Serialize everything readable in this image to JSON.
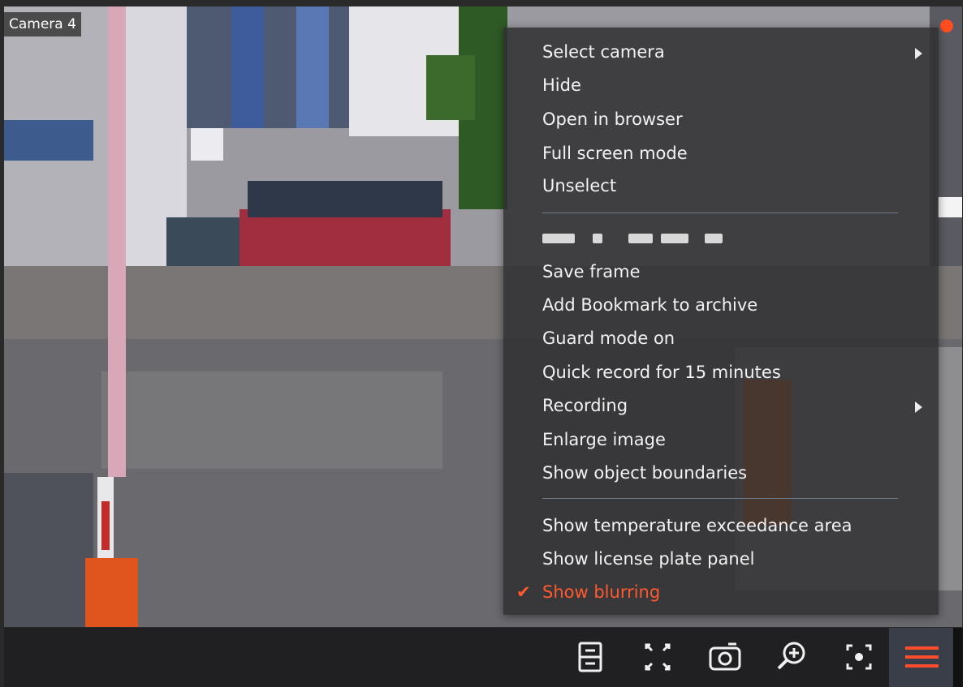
{
  "camera": {
    "label": "Camera 4",
    "recording_indicator_color": "#ff4d1f"
  },
  "context_menu": {
    "items": [
      {
        "label": "Select camera",
        "has_submenu": true
      },
      {
        "label": "Hide"
      },
      {
        "label": "Open in browser"
      },
      {
        "label": "Full screen mode"
      },
      {
        "label": "Unselect"
      },
      {
        "label": "Save frame"
      },
      {
        "label": "Add Bookmark to archive"
      },
      {
        "label": "Guard mode on"
      },
      {
        "label": "Quick record for 15 minutes"
      },
      {
        "label": "Recording",
        "has_submenu": true
      },
      {
        "label": "Enlarge image"
      },
      {
        "label": "Show object boundaries"
      },
      {
        "label": "Show temperature exceedance area"
      },
      {
        "label": "Show license plate panel"
      },
      {
        "label": "Show blurring",
        "checked": true
      }
    ],
    "checked_color": "#ff5a2e"
  },
  "toolbar": {
    "buttons": [
      {
        "icon": "layout-icon"
      },
      {
        "icon": "fullscreen-icon"
      },
      {
        "icon": "snapshot-icon"
      },
      {
        "icon": "zoom-in-icon"
      },
      {
        "icon": "focus-icon"
      },
      {
        "icon": "menu-icon",
        "active": true
      }
    ],
    "accent_color": "#ff4d2e"
  }
}
